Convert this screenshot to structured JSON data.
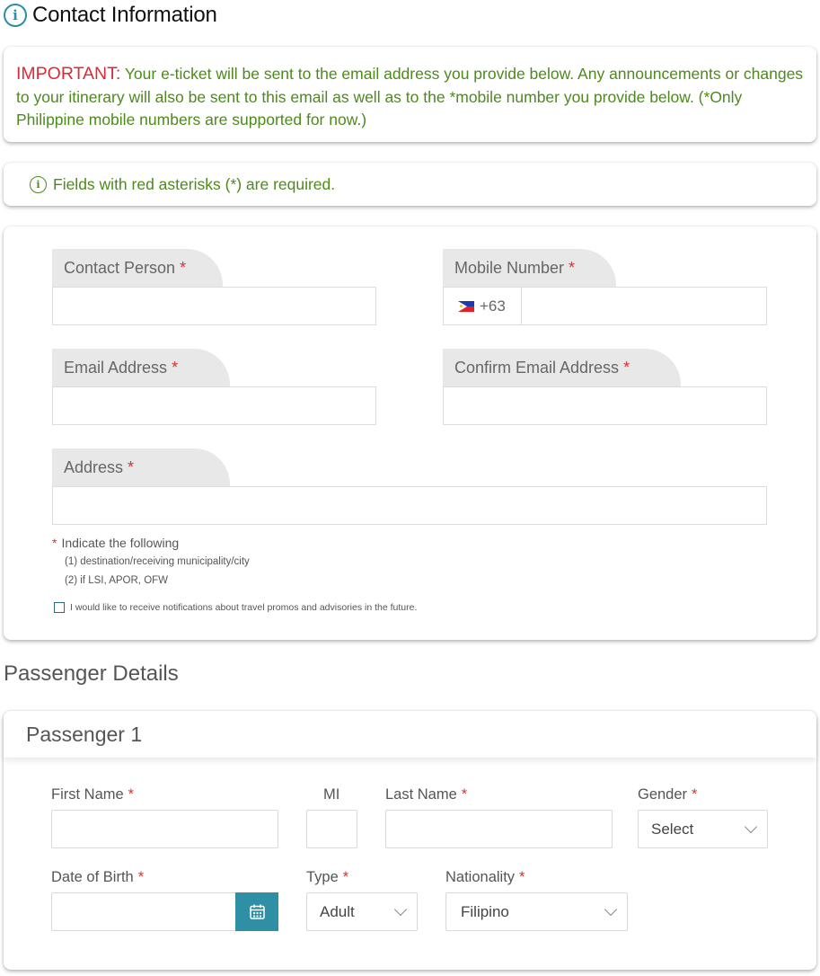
{
  "contact": {
    "title": "Contact Information",
    "important_label": "IMPORTANT:",
    "important_text": " Your e-ticket will be sent to the email address you provide below. Any announcements or changes to your itinerary will also be sent to this email as well as to the *mobile number you provide below. (*Only Philippine mobile numbers are supported for now.)",
    "required_note": "Fields with red asterisks (*) are required.",
    "fields": {
      "contact_person": "Contact Person",
      "mobile_number": "Mobile Number",
      "country_code": "+63",
      "email": "Email Address",
      "confirm_email": "Confirm Email Address",
      "address": "Address"
    },
    "required_mark": "*",
    "address_note": "Indicate the following",
    "address_note_1": "(1) destination/receiving municipality/city",
    "address_note_2": "(2) if LSI, APOR, OFW",
    "notifications_label": "I would like to receive notifications about travel promos and advisories in the future."
  },
  "passenger": {
    "section_title": "Passenger Details",
    "card_title": "Passenger 1",
    "labels": {
      "first_name": "First Name",
      "mi": "MI",
      "last_name": "Last Name",
      "gender": "Gender",
      "dob": "Date of Birth",
      "type": "Type",
      "nationality": "Nationality"
    },
    "selects": {
      "gender": "Select",
      "type": "Adult",
      "nationality": "Filipino"
    }
  },
  "colors": {
    "accent": "#2e8fa5",
    "important_red": "#dd2a34",
    "note_green": "#4d8a1c",
    "required_red": "#d63333"
  },
  "icons": {
    "info": "info-circle-icon",
    "flag": "philippines-flag-icon",
    "calendar": "calendar-icon",
    "chevron": "chevron-down-icon"
  }
}
